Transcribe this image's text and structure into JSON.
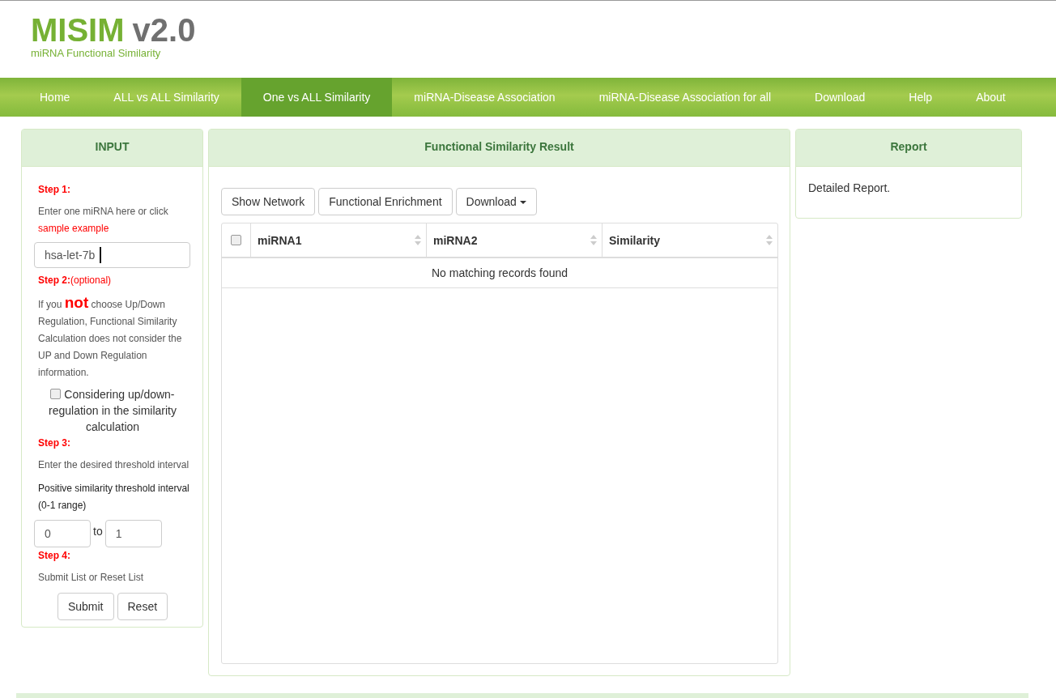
{
  "logo": {
    "title": "MISIM",
    "version": "v2.0",
    "subtitle": "miRNA Functional Similarity"
  },
  "nav": [
    {
      "label": "Home",
      "selected": false
    },
    {
      "label": "ALL vs ALL Similarity",
      "selected": false
    },
    {
      "label": "One vs ALL Similarity",
      "selected": true
    },
    {
      "label": "miRNA-Disease Association",
      "selected": false
    },
    {
      "label": "miRNA-Disease Association for all",
      "selected": false
    },
    {
      "label": "Download",
      "selected": false
    },
    {
      "label": "Help",
      "selected": false
    },
    {
      "label": "About",
      "selected": false
    }
  ],
  "input_panel": {
    "title": "INPUT",
    "step1": {
      "label": "Step 1:",
      "text": "Enter one miRNA here or click",
      "link": "sample example",
      "value": "hsa-let-7b"
    },
    "step2": {
      "label": "**Step 2:**(optional)",
      "text": "If you **not** choose Up/Down Regulation, Functional Similarity Calculation does not consider the UP and Down Regulation information.",
      "checkbox": {
        "label": "Considering up/down-regulation in the similarity calculation",
        "checked": false
      }
    },
    "step3": {
      "label": "Step 3:",
      "text": "Enter the desired threshold interval",
      "range_label": "Positive similarity threshold interval (0-1 range)",
      "from": "0",
      "to_label": "to",
      "to": "1"
    },
    "step4": {
      "label": "Step 4:",
      "text": "Submit List or Reset List",
      "buttons": [
        "Submit",
        "Reset"
      ]
    }
  },
  "result_panel": {
    "title": "Functional Similarity Result",
    "toolbar": [
      {
        "label": "Show Network",
        "kind": "button"
      },
      {
        "label": "Functional Enrichment",
        "kind": "button"
      },
      {
        "label": "Download",
        "kind": "dropdown"
      }
    ],
    "table": {
      "select_all_checked": false,
      "columns": [
        "miRNA1",
        "miRNA2",
        "Similarity"
      ],
      "empty_message": "No matching records found"
    }
  },
  "report_panel": {
    "title": "Report",
    "text": "Detailed Report."
  }
}
